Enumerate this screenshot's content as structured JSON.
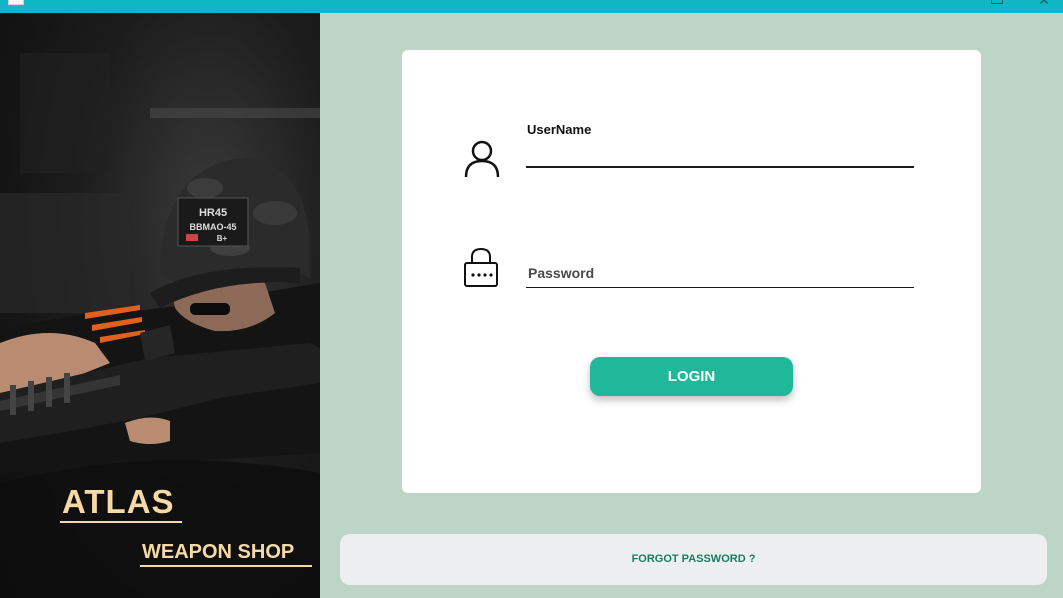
{
  "window": {
    "close_glyph": "✕",
    "accent_color": "#0fb6c4"
  },
  "brand": {
    "title": "ATLAS",
    "subtitle": "WEAPON SHOP",
    "text_color": "#f7d9a6",
    "cap_patch_lines": [
      "HR45",
      "BBMAO-45",
      "B+"
    ]
  },
  "login": {
    "username_label": "UserName",
    "username_value": "",
    "password_placeholder": "Password",
    "password_value": "",
    "button_label": "LOGIN",
    "button_color": "#1fb999"
  },
  "footer": {
    "forgot_password": "FORGOT PASSWORD ?"
  },
  "icons": {
    "user": "user-icon",
    "lock": "lock-icon"
  }
}
